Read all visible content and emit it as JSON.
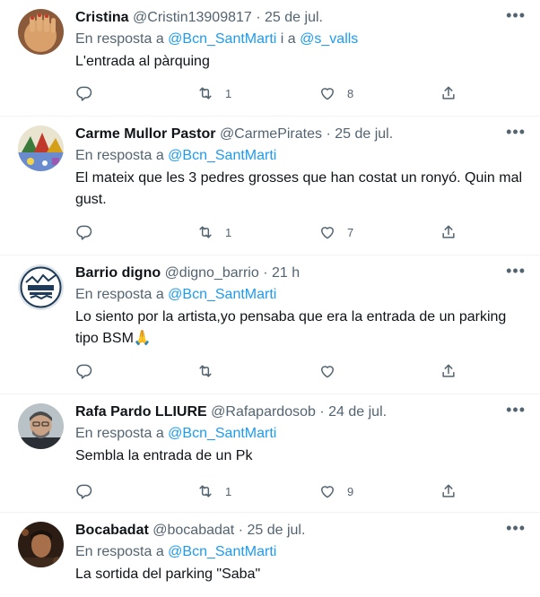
{
  "tweets": [
    {
      "name": "Cristina",
      "handle": "@Cristin13909817",
      "time": "· 25 de jul.",
      "reply_prefix": "En resposta a ",
      "mention1": "@Bcn_SantMarti",
      "joiner": " i a ",
      "mention2": "@s_valls",
      "text": "L'entrada al pàrquing",
      "retweets": "1",
      "likes": "8"
    },
    {
      "name": "Carme Mullor Pastor",
      "handle": "@CarmePirates",
      "time": "· 25 de jul.",
      "reply_prefix": "En resposta a ",
      "mention1": "@Bcn_SantMarti",
      "text": "El mateix que les 3 pedres grosses que han costat un ronyó. Quin mal gust.",
      "retweets": "1",
      "likes": "7"
    },
    {
      "name": "Barrio digno",
      "handle": "@digno_barrio",
      "time": "· 21 h",
      "reply_prefix": "En resposta a ",
      "mention1": "@Bcn_SantMarti",
      "text": "Lo siento por la artista,yo pensaba que era la entrada de un parking tipo BSM🙏",
      "retweets": "",
      "likes": ""
    },
    {
      "name": "Rafa Pardo LLIURE",
      "handle": "@Rafapardosob",
      "time": "· 24 de jul.",
      "reply_prefix": "En resposta a ",
      "mention1": "@Bcn_SantMarti",
      "text": "Sembla la entrada de un Pk",
      "retweets": "1",
      "likes": "9"
    },
    {
      "name": "Bocabadat",
      "handle": "@bocabadat",
      "time": "· 25 de jul.",
      "reply_prefix": "En resposta a ",
      "mention1": "@Bcn_SantMarti",
      "text": "La sortida del parking \"Saba\""
    }
  ],
  "icons": {
    "more": "more-icon",
    "reply": "reply-icon",
    "retweet": "retweet-icon",
    "like": "like-icon",
    "share": "share-icon"
  },
  "colors": {
    "accent": "#1d9bf0",
    "secondary": "#536471",
    "text": "#0f1419",
    "divider": "#eff3f4"
  }
}
